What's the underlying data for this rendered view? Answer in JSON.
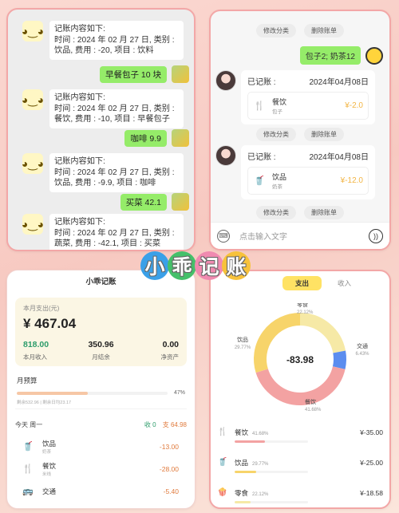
{
  "colors": {
    "wechat_green": "#95ec69",
    "accent_yellow": "#ffe264",
    "amount_orange": "#e07a3c",
    "income_green": "#2c9c6a",
    "pie_yellow": "#f7d46a",
    "pie_blue": "#5b8def",
    "pie_red": "#f3a2a2"
  },
  "logo": {
    "chars": [
      "小",
      "乖",
      "记",
      "账"
    ]
  },
  "chat": {
    "messages": [
      {
        "from": "bot",
        "lines": [
          "记账内容如下:",
          "时间 : 2024 年 02 月 27 日, 类别 :",
          "饮品, 费用 : -20, 项目 : 饮料"
        ]
      },
      {
        "from": "user",
        "text": "早餐包子 10 块"
      },
      {
        "from": "bot",
        "lines": [
          "记账内容如下:",
          "时间 : 2024 年 02 月 27 日, 类别 :",
          "餐饮, 费用 : -10, 项目 : 早餐包子"
        ]
      },
      {
        "from": "user",
        "text": "咖啡 9.9"
      },
      {
        "from": "bot",
        "lines": [
          "记账内容如下:",
          "时间 : 2024 年 02 月 27 日, 类别 :",
          "饮品, 费用 : -9.9, 项目 : 咖啡"
        ]
      },
      {
        "from": "user",
        "text": "买菜 42.1"
      },
      {
        "from": "bot",
        "lines": [
          "记账内容如下:",
          "时间 : 2024 年 02 月 27 日, 类别 :",
          "蔬菜, 费用 : -42.1, 项目 : 买菜"
        ]
      }
    ]
  },
  "ledger": {
    "chips": {
      "modify": "修改分类",
      "delete": "删除账单"
    },
    "sent_message": "包子2; 奶茶12",
    "cards": [
      {
        "title": "已记账 :",
        "date": "2024年04月08日",
        "item": "餐饮",
        "sub": "包子",
        "amount": "¥-2.0",
        "icon": "utensils-icon"
      },
      {
        "title": "已记账 :",
        "date": "2024年04月08日",
        "item": "饮品",
        "sub": "奶茶",
        "amount": "¥-12.0",
        "icon": "drink-icon"
      }
    ],
    "input_placeholder": "点击输入文字"
  },
  "stats": {
    "tab_title": "小乖记账",
    "month_label": "本月支出(元)",
    "month_total": "¥ 467.04",
    "income": {
      "value": "818.00",
      "label": "本月收入"
    },
    "balance": {
      "value": "350.96",
      "label": "月结余"
    },
    "net_assets": {
      "value": "0.00",
      "label": "净资产"
    },
    "budget": {
      "title": "月预算",
      "percent_text": "47%",
      "fill": 0.47,
      "sub": "剩余532.96 | 剩余日均23.17"
    },
    "day": {
      "label": "今天  周一",
      "in_label": "收 0",
      "out_label": "支 64.98"
    },
    "transactions": [
      {
        "name": "饮品",
        "sub": "奶茶",
        "amount": "-13.00",
        "icon": "drink-icon"
      },
      {
        "name": "餐饮",
        "sub": "米线",
        "amount": "-28.00",
        "icon": "utensils-icon"
      },
      {
        "name": "交通",
        "sub": "",
        "amount": "-5.40",
        "icon": "bus-icon"
      }
    ]
  },
  "pie": {
    "tabs": {
      "expense": "支出",
      "income": "收入"
    },
    "center_value": "-83.98",
    "slices": [
      {
        "name": "饮品",
        "pct_text": "29.77%",
        "fraction": 0.2977,
        "color": "#f7d46a"
      },
      {
        "name": "零食",
        "pct_text": "22.12%",
        "fraction": 0.2212,
        "color": "#f6e9a6"
      },
      {
        "name": "交通",
        "pct_text": "6.43%",
        "fraction": 0.0643,
        "color": "#5b8def"
      },
      {
        "name": "餐饮",
        "pct_text": "41.68%",
        "fraction": 0.4168,
        "color": "#f3a2a2"
      }
    ],
    "categories": [
      {
        "name": "餐饮",
        "pct": "41.68%",
        "amount": "¥-35.00",
        "fill": 0.4168,
        "icon": "utensils-icon",
        "color": "#f3a2a2"
      },
      {
        "name": "饮品",
        "pct": "29.77%",
        "amount": "¥-25.00",
        "fill": 0.2977,
        "icon": "drink-icon",
        "color": "#f7d46a"
      },
      {
        "name": "零食",
        "pct": "22.12%",
        "amount": "¥-18.58",
        "fill": 0.2212,
        "icon": "snack-icon",
        "color": "#f6e9a6"
      }
    ]
  }
}
